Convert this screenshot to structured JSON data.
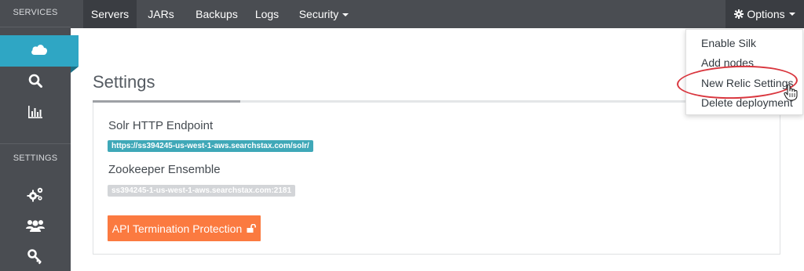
{
  "sidebar": {
    "services_heading": "SERVICES",
    "settings_heading": "SETTINGS",
    "service_items": [
      {
        "icon": "cloud-icon"
      },
      {
        "icon": "search-icon"
      },
      {
        "icon": "bar-chart-icon"
      }
    ],
    "settings_items": [
      {
        "icon": "gears-icon"
      },
      {
        "icon": "users-icon"
      },
      {
        "icon": "key-icon"
      }
    ]
  },
  "navbar": {
    "tabs": [
      {
        "label": "Servers"
      },
      {
        "label": "JARs"
      },
      {
        "label": "Backups"
      },
      {
        "label": "Logs"
      },
      {
        "label": "Security"
      }
    ],
    "options_label": "Options"
  },
  "options_menu": {
    "items": [
      {
        "label": "Enable Silk"
      },
      {
        "label": "Add nodes"
      },
      {
        "label": "New Relic Settings"
      },
      {
        "label": "Delete deployment"
      }
    ]
  },
  "main": {
    "title": "Settings",
    "solr_label": "Solr HTTP Endpoint",
    "solr_value": "https://ss394245-us-west-1-aws.searchstax.com/solr/",
    "zk_label": "Zookeeper Ensemble",
    "zk_value": "ss394245-1-us-west-1-aws.searchstax.com:2181",
    "api_button_label": "API Termination Protection"
  },
  "colors": {
    "sidebar_bg": "#4a4d52",
    "active_item": "#2fa6c4",
    "accent_button": "#fb7a40",
    "badge_teal": "#3fa8b8",
    "highlight": "#d9363e"
  }
}
